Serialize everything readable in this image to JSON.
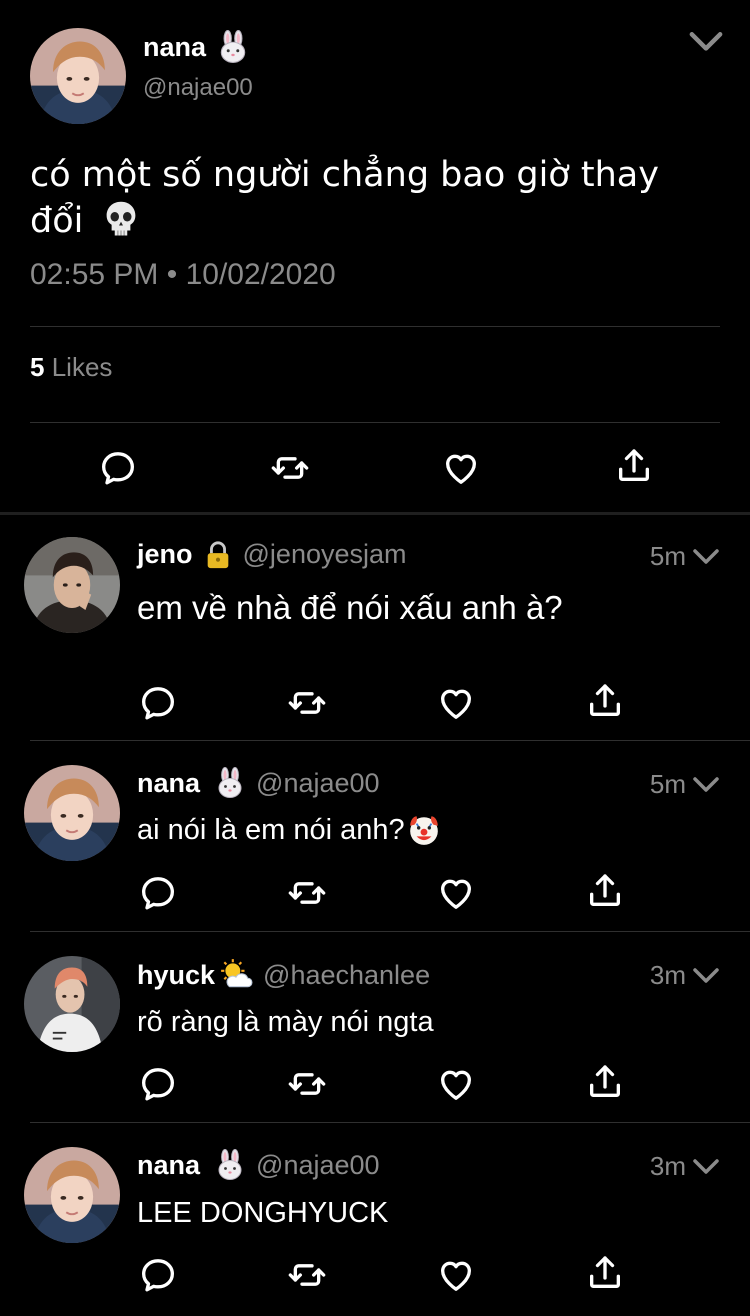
{
  "main_tweet": {
    "author_name": "nana",
    "author_emoji": "rabbit-face",
    "author_handle": "@najae00",
    "text_line1": "có một số người chẳng bao giờ thay",
    "text_line2": "đổi",
    "text_emoji": "skull",
    "timestamp": "02:55 PM • 10/02/2020",
    "likes_count": "5",
    "likes_label": "Likes"
  },
  "replies": [
    {
      "name": "jeno",
      "badge": "lock",
      "handle": "@jenoyesjam",
      "time": "5m",
      "text": "em về nhà để nói xấu anh à?"
    },
    {
      "name": "nana",
      "badge": "rabbit-face",
      "handle": "@najae00",
      "time": "5m",
      "text": "ai nói là em nói anh?",
      "text_emoji": "clown-face"
    },
    {
      "name": "hyuck",
      "badge": "sun-behind-cloud",
      "handle": "@haechanlee",
      "time": "3m",
      "text": "rõ ràng là mày nói ngta"
    },
    {
      "name": "nana",
      "badge": "rabbit-face",
      "handle": "@najae00",
      "time": "3m",
      "text": "LEE DONGHYUCK"
    }
  ],
  "colors": {
    "background": "#000000",
    "text": "#ffffff",
    "secondary": "#8b8b8b",
    "divider": "#2f2f2f"
  }
}
